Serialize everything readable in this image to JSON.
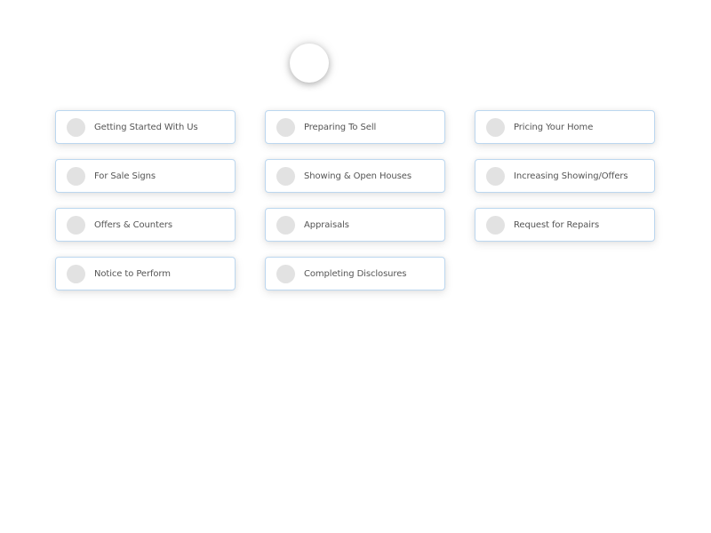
{
  "hero": {
    "icon": "circle-avatar"
  },
  "topics": [
    {
      "label": "Getting Started With Us",
      "icon": "topic-dot"
    },
    {
      "label": "Preparing To Sell",
      "icon": "topic-dot"
    },
    {
      "label": "Pricing Your Home",
      "icon": "topic-dot"
    },
    {
      "label": "For Sale Signs",
      "icon": "topic-dot"
    },
    {
      "label": "Showing & Open Houses",
      "icon": "topic-dot"
    },
    {
      "label": "Increasing Showing/Offers",
      "icon": "topic-dot"
    },
    {
      "label": "Offers & Counters",
      "icon": "topic-dot"
    },
    {
      "label": "Appraisals",
      "icon": "topic-dot"
    },
    {
      "label": "Request for Repairs",
      "icon": "topic-dot"
    },
    {
      "label": "Notice to Perform",
      "icon": "topic-dot"
    },
    {
      "label": "Completing Disclosures",
      "icon": "topic-dot"
    }
  ],
  "colors": {
    "card_border": "#bcd7ef",
    "dot": "#e2e2e2",
    "text": "#555555"
  }
}
